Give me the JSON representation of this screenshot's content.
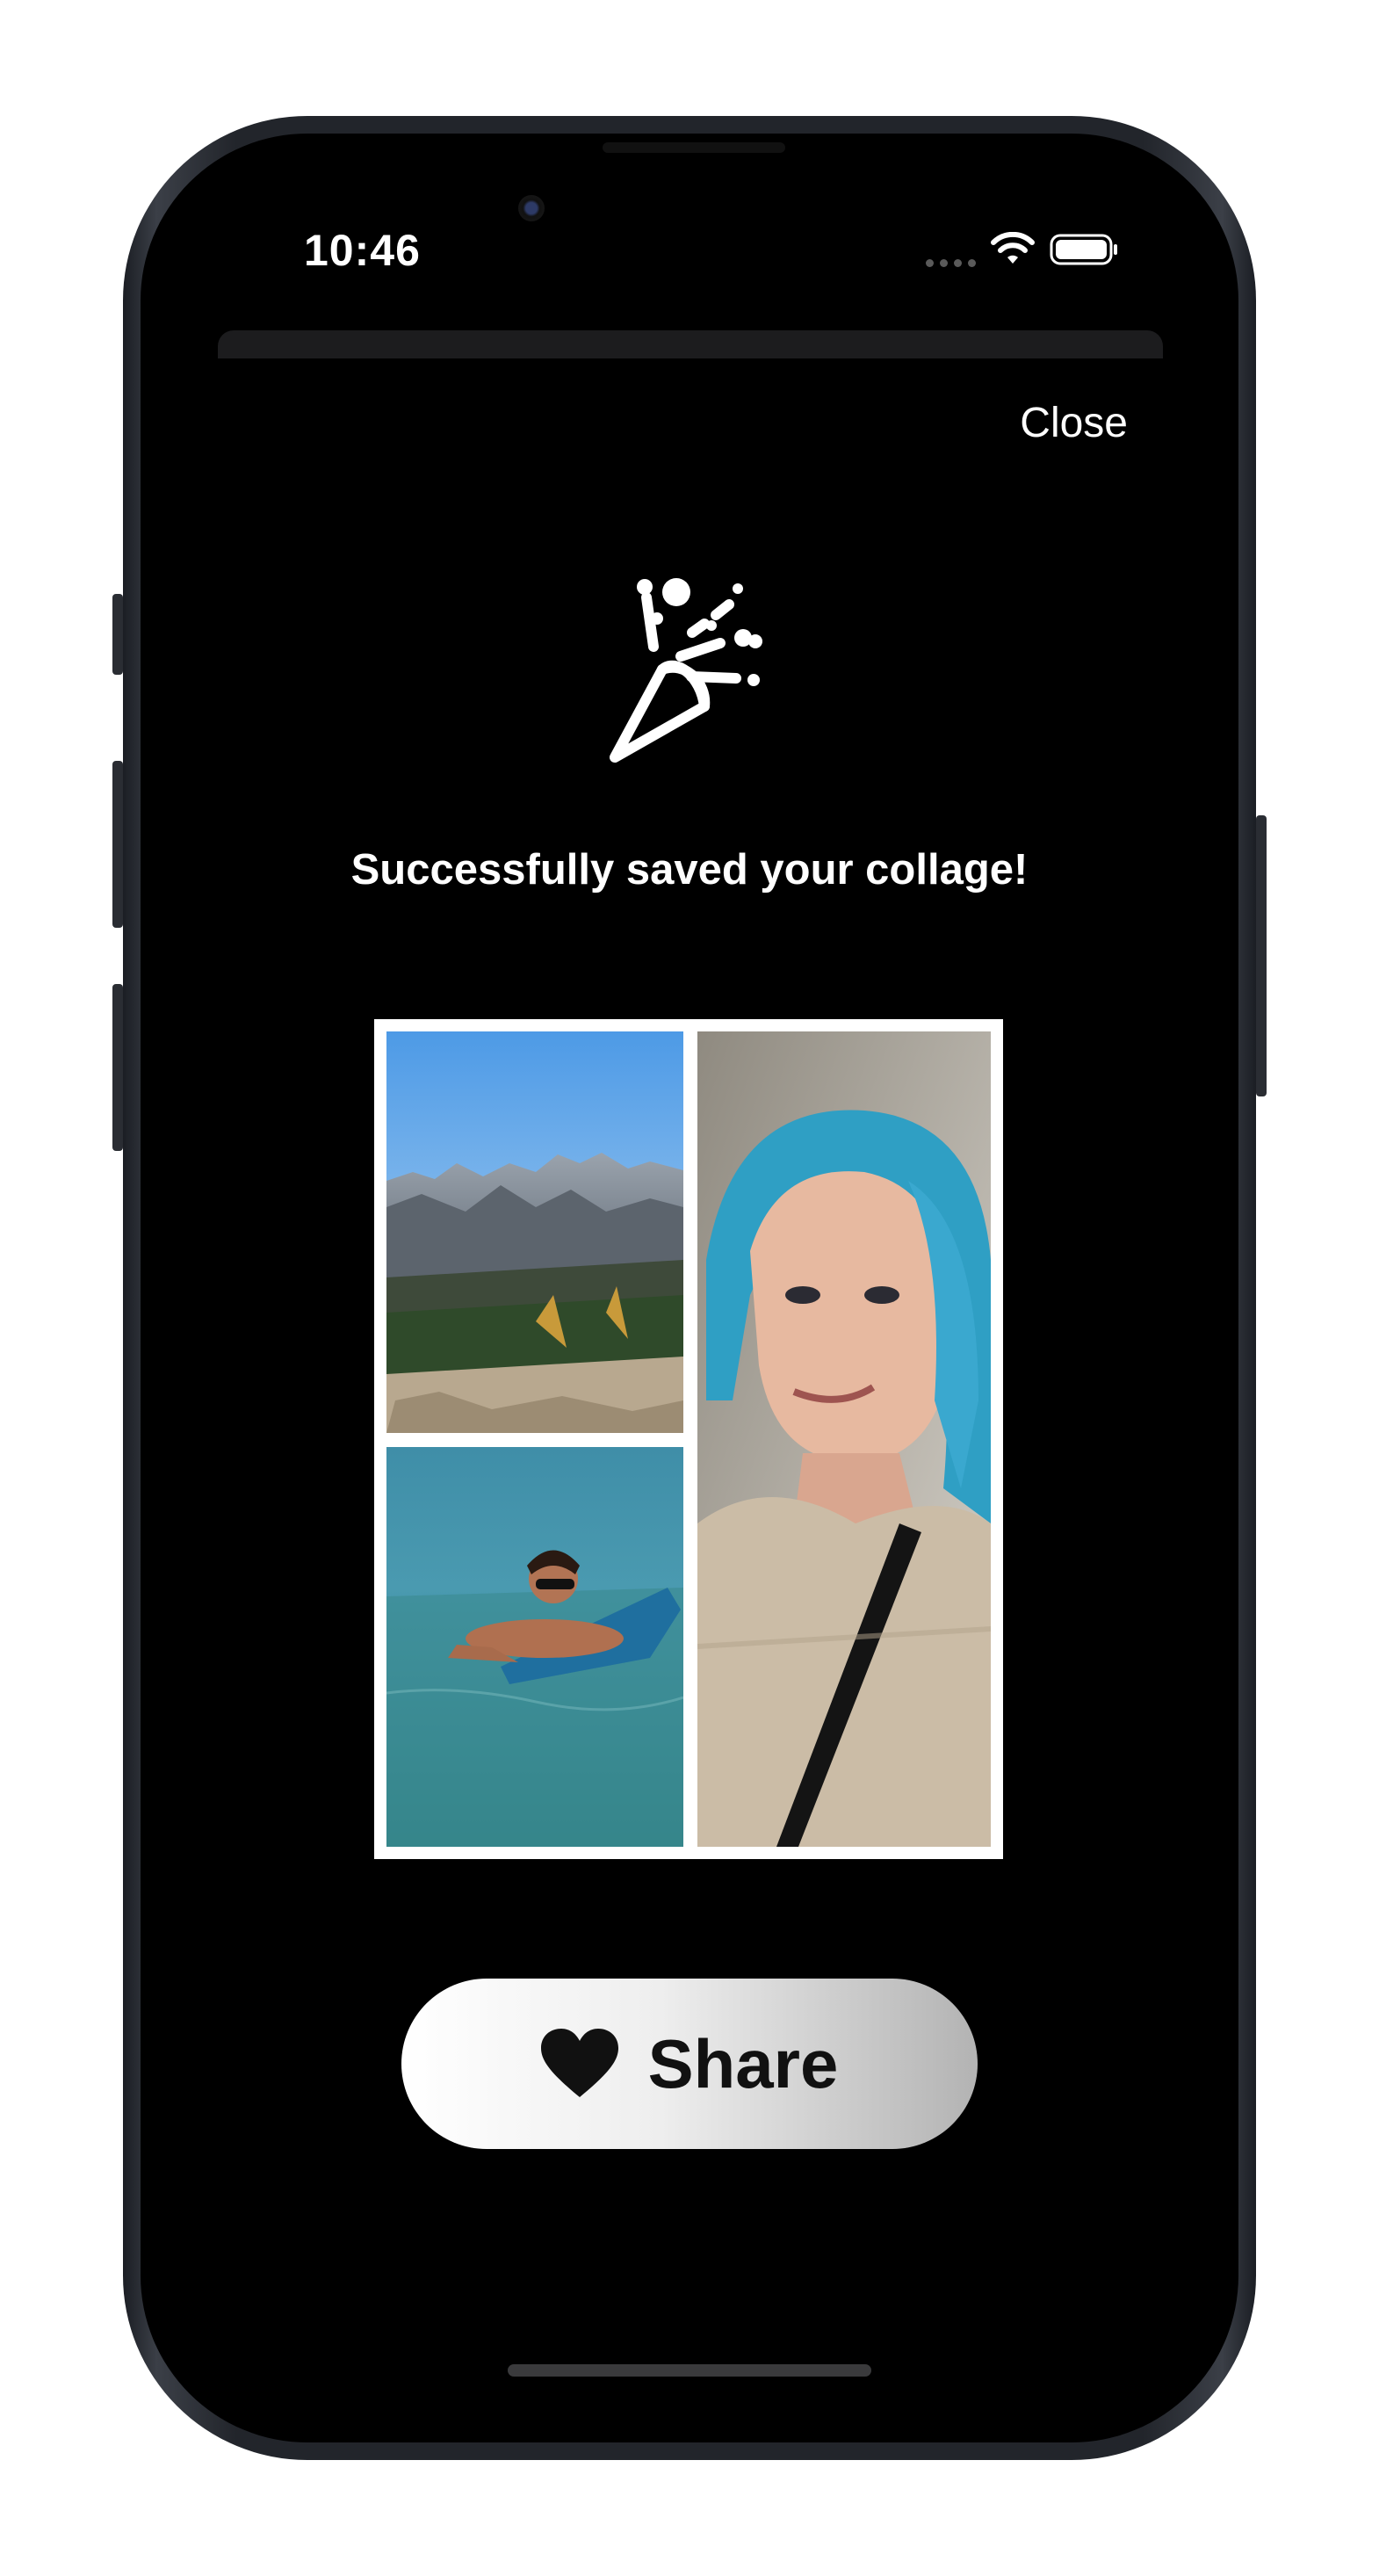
{
  "status_bar": {
    "time": "10:46",
    "wifi_icon": "wifi-icon",
    "battery_icon": "battery-icon"
  },
  "header": {
    "close_label": "Close"
  },
  "celebration": {
    "icon": "party-popper-icon",
    "message": "Successfully saved your collage!"
  },
  "collage": {
    "photos": [
      {
        "icon": "mountain-landscape-photo"
      },
      {
        "icon": "man-surfing-photo"
      },
      {
        "icon": "woman-blue-hair-portrait-photo"
      }
    ]
  },
  "share_button": {
    "label": "Share",
    "icon": "heart-icon"
  }
}
